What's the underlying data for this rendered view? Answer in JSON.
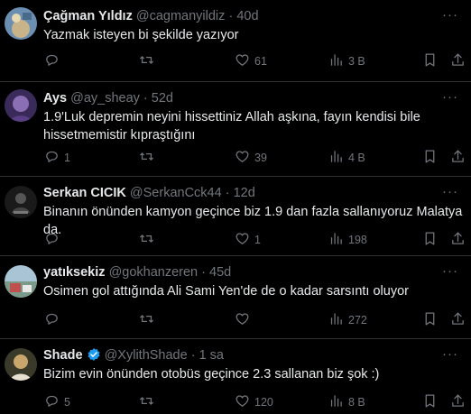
{
  "tweets": [
    {
      "name": "Çağman Yıldız",
      "handle": "@cagmanyildiz",
      "sep": "·",
      "time": "40d",
      "text": "Yazmak isteyen bi şekilde yazıyor",
      "replies": "",
      "retweets": "",
      "likes": "61",
      "views": "3 B",
      "verified": false,
      "avatar_color": "#6b8fb3"
    },
    {
      "name": "Ays",
      "handle": "@ay_sheay",
      "sep": "·",
      "time": "52d",
      "text": "1.9'Luk depremin neyini hissettiniz Allah aşkına, fayın kendisi bile hissetmemistir kıpraştığını",
      "replies": "1",
      "retweets": "",
      "likes": "39",
      "views": "4 B",
      "verified": false,
      "avatar_color": "#3a2a5a"
    },
    {
      "name": "Serkan CICIK",
      "handle": "@SerkanCck44",
      "sep": "·",
      "time": "12d",
      "text": "Binanın önünden kamyon geçince biz 1.9 dan fazla sallanıyoruz Malatya da.",
      "replies": "",
      "retweets": "",
      "likes": "1",
      "views": "198",
      "verified": false,
      "avatar_color": "#1a1a1a"
    },
    {
      "name": "yatıksekiz",
      "handle": "@gokhanzeren",
      "sep": "·",
      "time": "45d",
      "text": "Osimen gol attığında Ali Sami Yen'de de o kadar sarsıntı oluyor",
      "replies": "",
      "retweets": "",
      "likes": "",
      "views": "272",
      "verified": false,
      "avatar_color": "#7a9a8a"
    },
    {
      "name": "Shade",
      "handle": "@XylithShade",
      "sep": "·",
      "time": "1 sa",
      "text": "Bizim evin önünden otobüs geçince 2.3 sallanan biz şok :)",
      "replies": "5",
      "retweets": "",
      "likes": "120",
      "views": "8 B",
      "verified": true,
      "avatar_color": "#c9a66b"
    }
  ],
  "colors": {
    "background": "#000000",
    "text": "#e7e9ea",
    "muted": "#71767b",
    "border": "#2f3336",
    "verified": "#1d9bf0"
  },
  "icons": [
    "reply-icon",
    "retweet-icon",
    "like-icon",
    "views-icon",
    "bookmark-icon",
    "share-icon",
    "more-icon",
    "verified-icon"
  ]
}
